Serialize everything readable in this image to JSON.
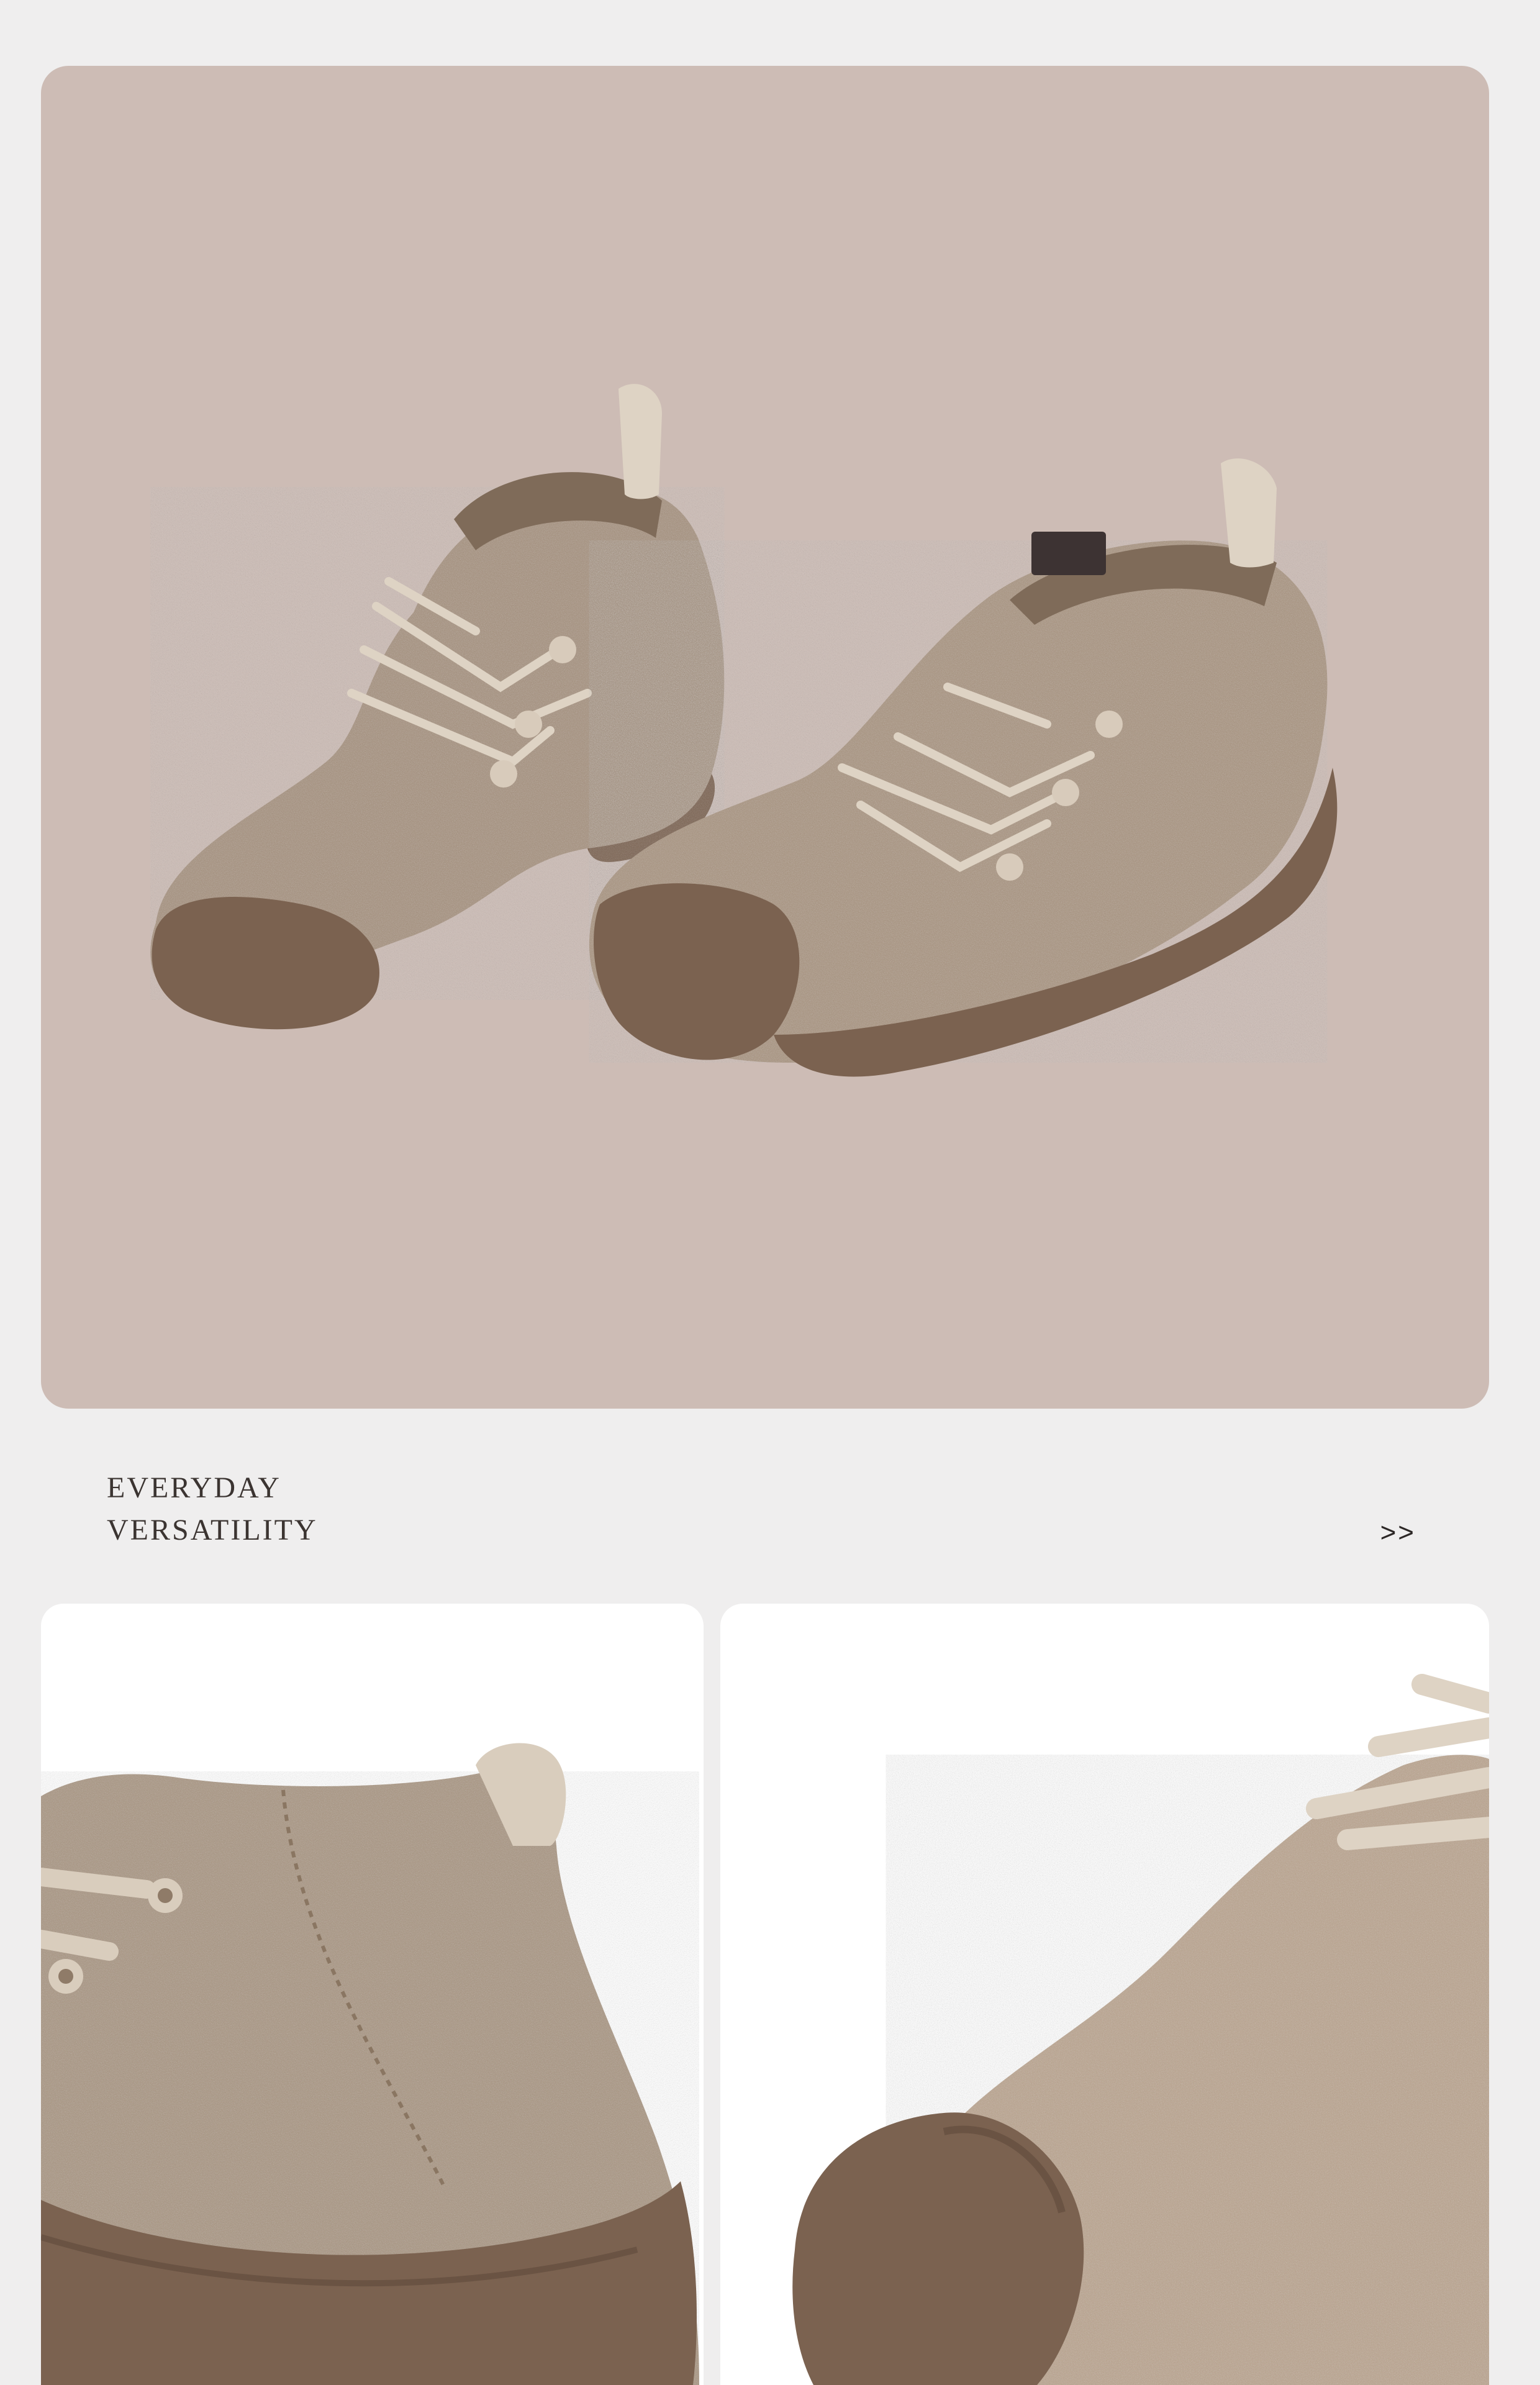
{
  "caption": {
    "line1": "EVERYDAY",
    "line2": "VERSATILITY"
  },
  "more_link": {
    "label": ">>"
  },
  "colors": {
    "page_background": "#efeeee",
    "hero_background": "#cdbcb5",
    "felt": "#9f8a76",
    "felt_dark": "#7f6b59",
    "sole": "#7b6250",
    "lace": "#ded3c4",
    "text": "#3b3431"
  },
  "images": {
    "hero": "pair-of-felt-lace-up-shoes",
    "detail_left": "felt-shoe-heel-closeup",
    "detail_right": "felt-shoe-toe-closeup"
  }
}
